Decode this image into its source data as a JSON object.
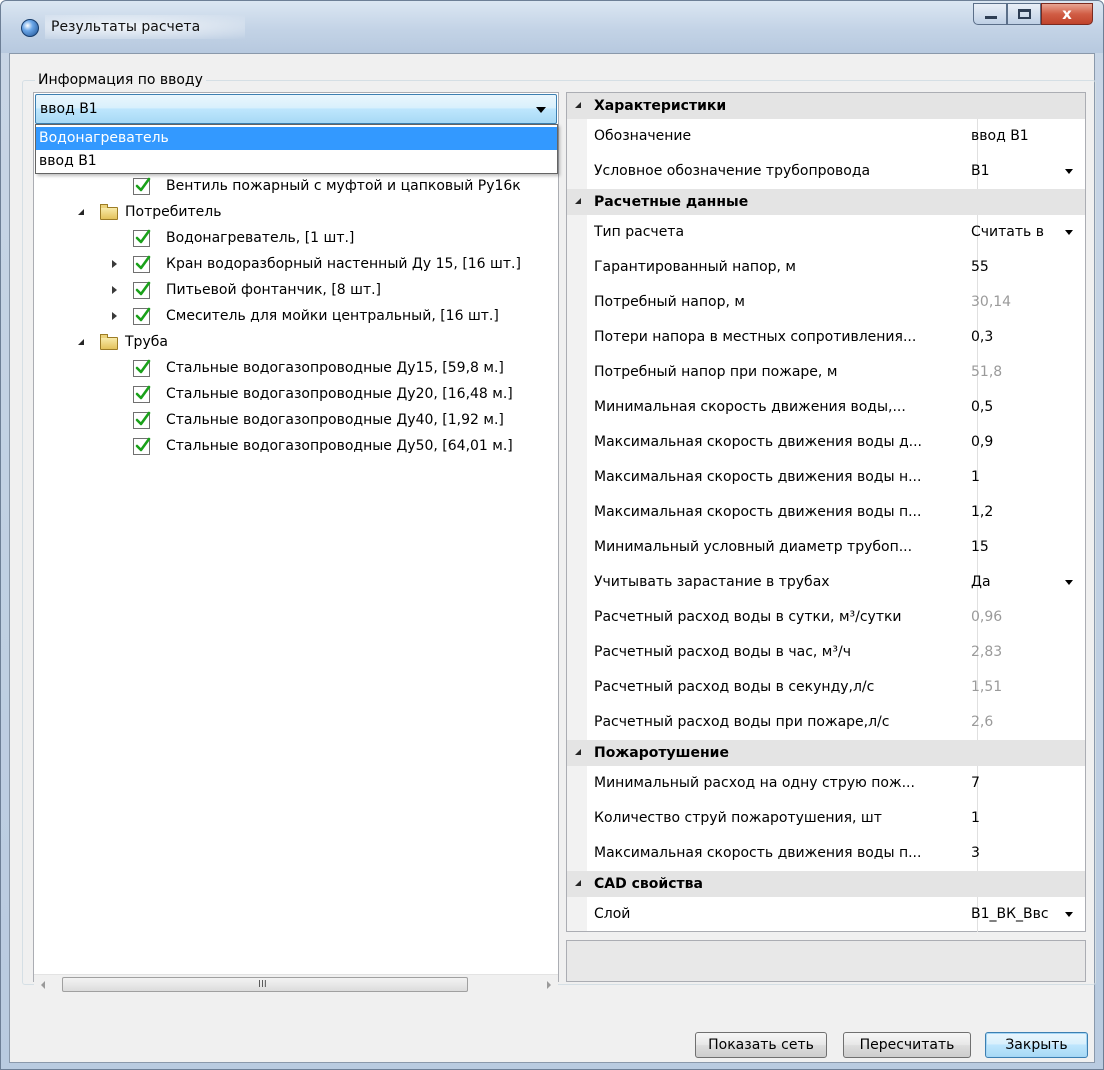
{
  "window": {
    "title": "Результаты расчета",
    "close_glyph": "x"
  },
  "group": {
    "label": "Информация по вводу"
  },
  "combo": {
    "selected": "ввод В1",
    "options": [
      {
        "label": "Водонагреватель",
        "highlighted": true
      },
      {
        "label": "ввод В1",
        "highlighted": false
      }
    ]
  },
  "tree": {
    "items": [
      {
        "label": "Вентиль пожарный с муфтой и цапковый Ру16к",
        "level": 2,
        "checked": true
      },
      {
        "label": "Потребитель",
        "level": 1,
        "folder": true,
        "expanded": true
      },
      {
        "label": "Водонагреватель, [1 шт.]",
        "level": 2,
        "checked": true
      },
      {
        "label": "Кран водоразборный настенный Ду 15, [16 шт.]",
        "level": 2,
        "checked": true,
        "collapsed_arrow": true
      },
      {
        "label": "Питьевой фонтанчик, [8 шт.]",
        "level": 2,
        "checked": true,
        "collapsed_arrow": true
      },
      {
        "label": "Смеситель для мойки центральный, [16 шт.]",
        "level": 2,
        "checked": true,
        "collapsed_arrow": true
      },
      {
        "label": "Труба",
        "level": 1,
        "folder": true,
        "expanded": true
      },
      {
        "label": "Стальные водогазопроводные Ду15, [59,8 м.]",
        "level": 2,
        "checked": true
      },
      {
        "label": "Стальные водогазопроводные Ду20, [16,48 м.]",
        "level": 2,
        "checked": true
      },
      {
        "label": "Стальные водогазопроводные Ду40, [1,92 м.]",
        "level": 2,
        "checked": true
      },
      {
        "label": "Стальные водогазопроводные Ду50, [64,01 м.]",
        "level": 2,
        "checked": true
      }
    ],
    "scroll_grip": "III"
  },
  "properties": {
    "categories": [
      {
        "name": "Характеристики",
        "rows": [
          {
            "name": "Обозначение",
            "value": "ввод В1",
            "readonly": false,
            "dropdown": false
          },
          {
            "name": "Условное обозначение трубопровода",
            "value": "В1",
            "readonly": false,
            "dropdown": true
          }
        ]
      },
      {
        "name": "Расчетные данные",
        "rows": [
          {
            "name": "Тип расчета",
            "value": "Считать в",
            "readonly": false,
            "dropdown": true
          },
          {
            "name": "Гарантированный напор, м",
            "value": "55",
            "readonly": false,
            "dropdown": false
          },
          {
            "name": "Потребный напор, м",
            "value": "30,14",
            "readonly": true,
            "dropdown": false
          },
          {
            "name": "Потери напора в местных сопротивления...",
            "value": "0,3",
            "readonly": false,
            "dropdown": false
          },
          {
            "name": "Потребный напор при пожаре, м",
            "value": "51,8",
            "readonly": true,
            "dropdown": false
          },
          {
            "name": "Минимальная скорость движения воды,...",
            "value": "0,5",
            "readonly": false,
            "dropdown": false
          },
          {
            "name": "Максимальная скорость движения воды д...",
            "value": "0,9",
            "readonly": false,
            "dropdown": false
          },
          {
            "name": "Максимальная скорость движения воды н...",
            "value": "1",
            "readonly": false,
            "dropdown": false
          },
          {
            "name": "Максимальная скорость движения воды п...",
            "value": "1,2",
            "readonly": false,
            "dropdown": false
          },
          {
            "name": "Минимальный условный диаметр трубоп...",
            "value": "15",
            "readonly": false,
            "dropdown": false
          },
          {
            "name": "Учитывать зарастание в трубах",
            "value": "Да",
            "readonly": false,
            "dropdown": true
          },
          {
            "name": "Расчетный расход воды в сутки, м³/сутки",
            "value": "0,96",
            "readonly": true,
            "dropdown": false
          },
          {
            "name": "Расчетный расход воды в час, м³/ч",
            "value": "2,83",
            "readonly": true,
            "dropdown": false
          },
          {
            "name": "Расчетный расход воды в секунду,л/с",
            "value": "1,51",
            "readonly": true,
            "dropdown": false
          },
          {
            "name": "Расчетный расход воды при пожаре,л/с",
            "value": "2,6",
            "readonly": true,
            "dropdown": false
          }
        ]
      },
      {
        "name": "Пожаротушение",
        "rows": [
          {
            "name": "Минимальный расход на одну струю пож...",
            "value": "7",
            "readonly": false,
            "dropdown": false
          },
          {
            "name": "Количество струй пожаротушения, шт",
            "value": "1",
            "readonly": false,
            "dropdown": false
          },
          {
            "name": "Максимальная скорость движения воды п...",
            "value": "3",
            "readonly": false,
            "dropdown": false
          }
        ]
      },
      {
        "name": "CAD свойства",
        "rows": [
          {
            "name": "Слой",
            "value": "В1_ВК_Ввс",
            "readonly": false,
            "dropdown": true
          }
        ]
      }
    ]
  },
  "buttons": {
    "show_network": "Показать сеть",
    "recalculate": "Пересчитать",
    "close": "Закрыть"
  }
}
